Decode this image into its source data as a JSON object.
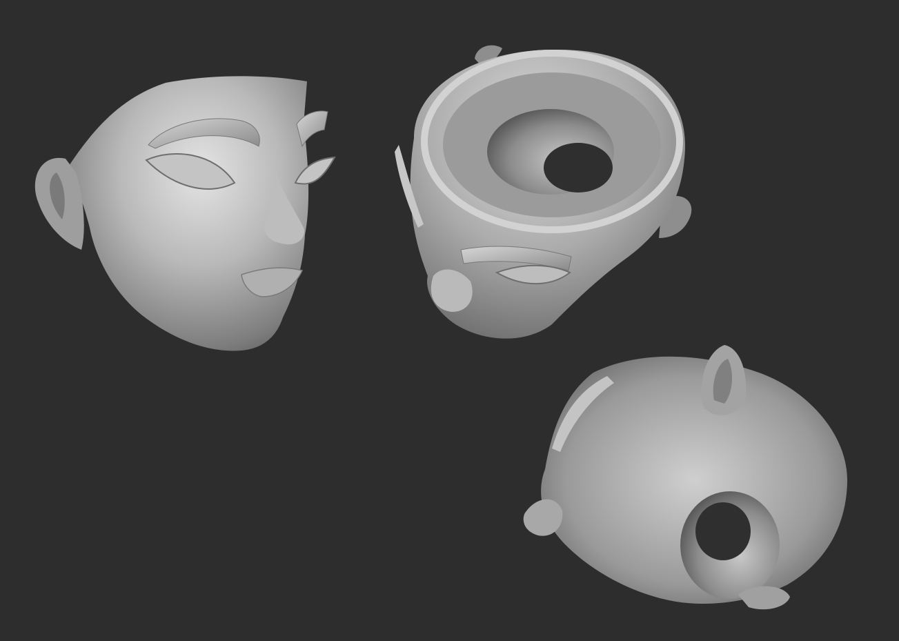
{
  "scene": {
    "background_color": "#2d2d2d",
    "model_color": "#a8a8a8",
    "models": [
      {
        "name": "head-front-three-quarter-view"
      },
      {
        "name": "head-top-down-view"
      },
      {
        "name": "head-back-view"
      }
    ]
  }
}
